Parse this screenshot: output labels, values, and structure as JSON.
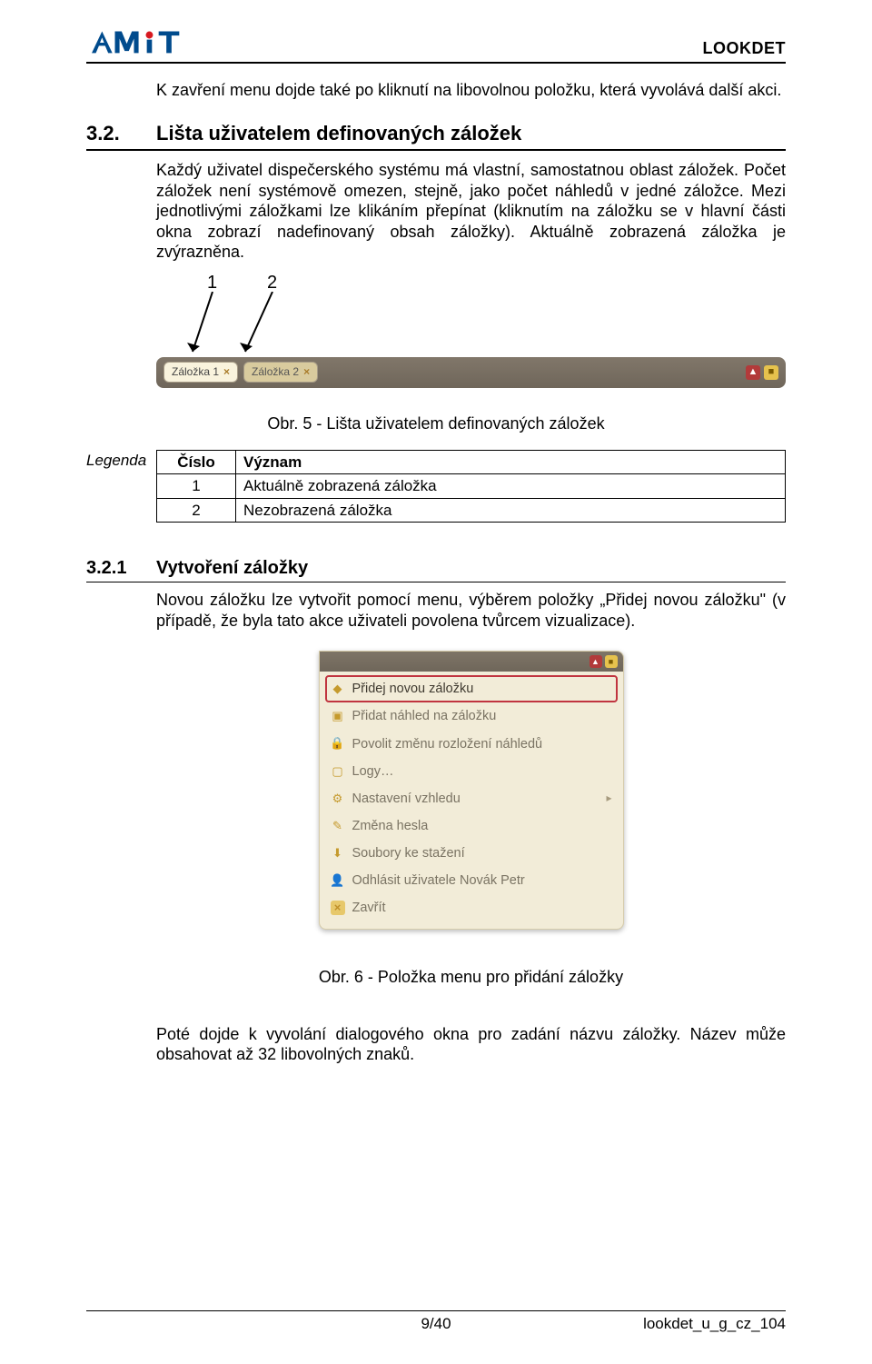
{
  "header": {
    "docname": "LOOKDET"
  },
  "intro": {
    "p1": "K zavření menu dojde také po kliknutí na libovolnou položku, která vyvolává další akci."
  },
  "section32": {
    "num": "3.2.",
    "title": "Lišta uživatelem definovaných záložek",
    "p1": "Každý uživatel dispečerského systému má vlastní, samostatnou oblast záložek. Počet záložek není systémově omezen, stejně, jako počet náhledů v jedné záložce. Mezi jednotlivými záložkami lze klikáním přepínat (kliknutím na záložku se v hlavní části okna zobrazí nadefinovaný obsah záložky). Aktuálně zobrazená záložka je zvýrazněna."
  },
  "fig5": {
    "callout1": "1",
    "callout2": "2",
    "tabs": [
      {
        "label": "Záložka 1",
        "active": true
      },
      {
        "label": "Záložka 2",
        "active": false
      }
    ],
    "caption": "Obr. 5 - Lišta uživatelem definovaných záložek"
  },
  "legend": {
    "label": "Legenda",
    "head_num": "Číslo",
    "head_mean": "Význam",
    "rows": [
      {
        "n": "1",
        "m": "Aktuálně zobrazená záložka"
      },
      {
        "n": "2",
        "m": "Nezobrazená záložka"
      }
    ]
  },
  "section321": {
    "num": "3.2.1",
    "title": "Vytvoření záložky",
    "p1": "Novou záložku lze vytvořit pomocí menu, výběrem položky „Přidej novou záložku\" (v případě, že byla tato akce uživateli povolena tvůrcem vizualizace)."
  },
  "fig6": {
    "items": [
      {
        "label": "Přidej novou záložku",
        "icon": "tag",
        "highlight": true
      },
      {
        "label": "Přidat náhled na záložku",
        "icon": "window+"
      },
      {
        "label": "Povolit změnu rozložení náhledů",
        "icon": "lock"
      },
      {
        "label": "Logy…",
        "icon": "box"
      },
      {
        "label": "Nastavení vzhledu",
        "icon": "gear",
        "sub": true
      },
      {
        "label": "Změna hesla",
        "icon": "pencil"
      },
      {
        "label": "Soubory ke stažení",
        "icon": "download"
      },
      {
        "label": "Odhlásit uživatele Novák Petr",
        "icon": "user"
      },
      {
        "label": "Zavřít",
        "icon": "close"
      }
    ],
    "caption": "Obr. 6 - Položka menu pro přidání záložky"
  },
  "trailing": {
    "p1": "Poté dojde k vyvolání dialogového okna pro zadání názvu záložky. Název může obsahovat až 32 libovolných znaků."
  },
  "footer": {
    "center": "9/40",
    "right": "lookdet_u_g_cz_104"
  }
}
